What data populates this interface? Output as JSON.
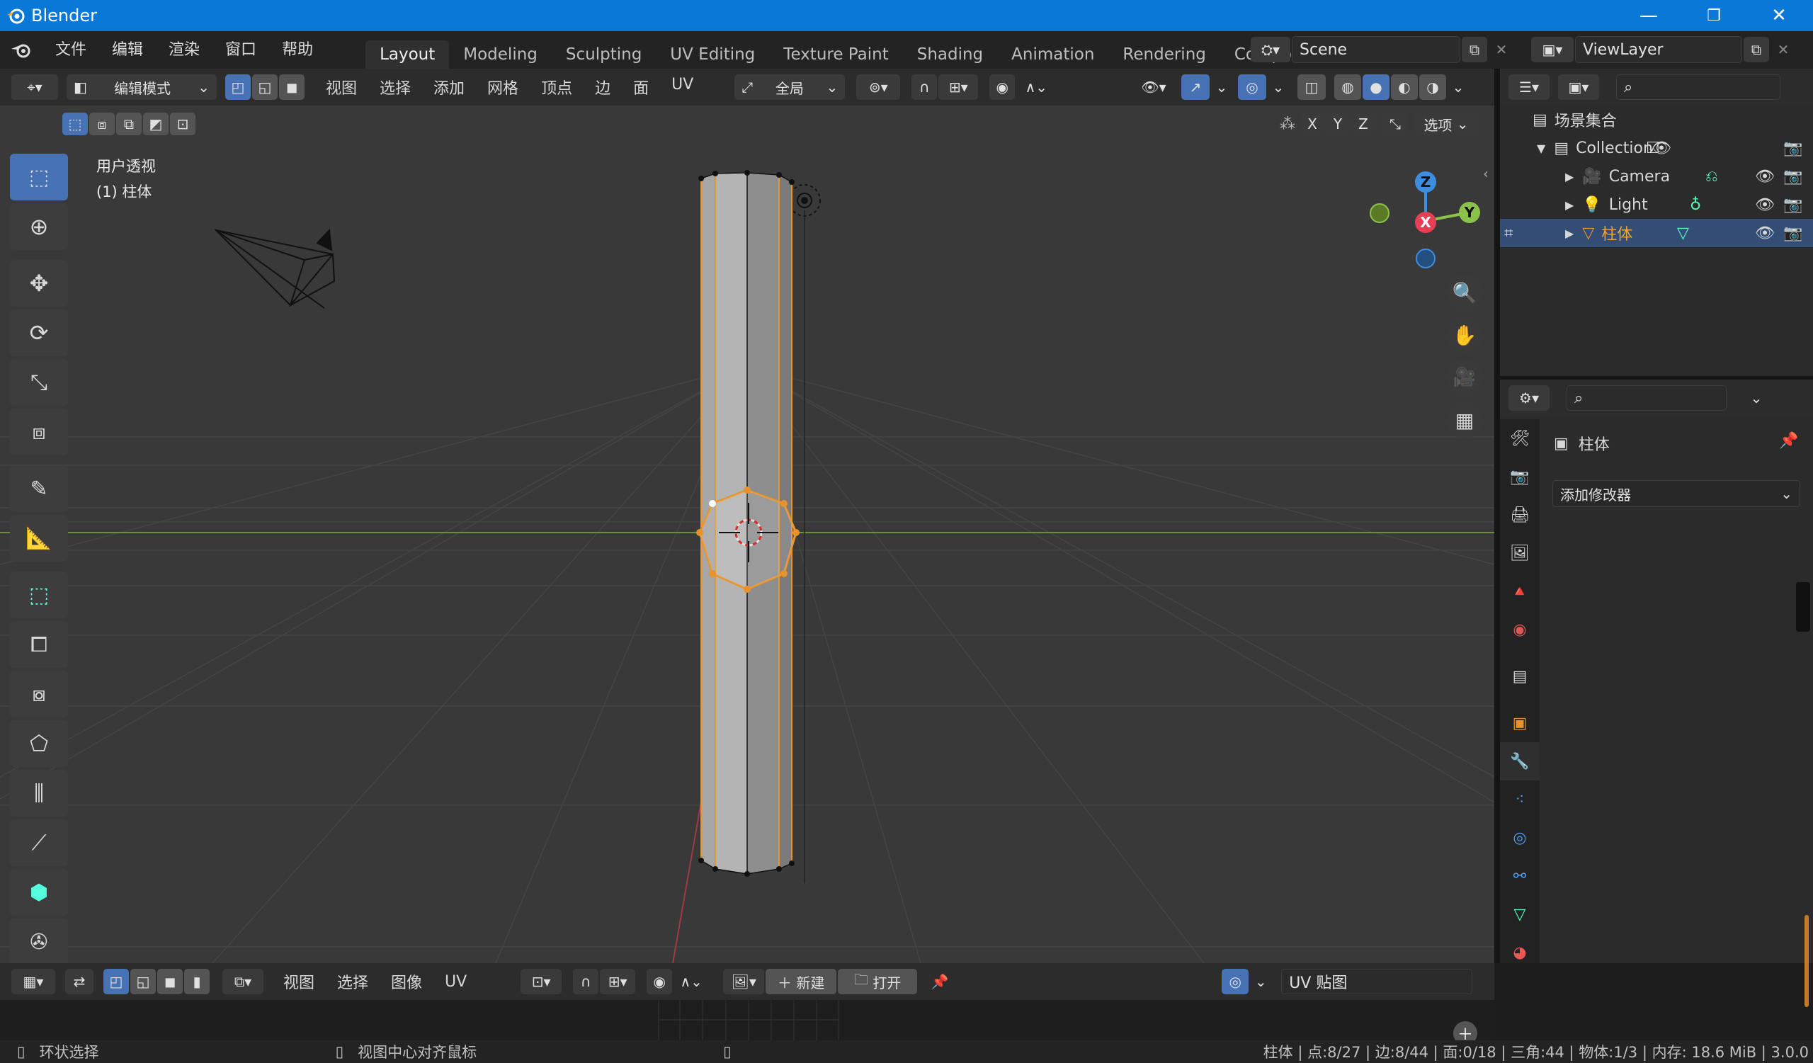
{
  "window": {
    "title": "Blender",
    "minimize": "—",
    "maximize": "❐",
    "close": "✕"
  },
  "menu": [
    "文件",
    "编辑",
    "渲染",
    "窗口",
    "帮助"
  ],
  "workspaces": [
    "Layout",
    "Modeling",
    "Sculpting",
    "UV Editing",
    "Texture Paint",
    "Shading",
    "Animation",
    "Rendering",
    "Compositing"
  ],
  "active_workspace": "Layout",
  "scene": {
    "name": "Scene"
  },
  "view_layer": {
    "name": "ViewLayer"
  },
  "viewport": {
    "mode": "编辑模式",
    "menus": [
      "视图",
      "选择",
      "添加",
      "网格",
      "顶点",
      "边",
      "面",
      "UV"
    ],
    "transform_orientation": "全局",
    "axis_labels": [
      "X",
      "Y",
      "Z"
    ],
    "options_label": "选项",
    "overlay_title": "用户透视",
    "overlay_object": "(1) 柱体",
    "gizmo": {
      "z": "Z",
      "y": "Y",
      "x": "X"
    }
  },
  "outliner": {
    "scene_collection": "场景集合",
    "items": [
      {
        "name": "Collection"
      },
      {
        "name": "Camera"
      },
      {
        "name": "Light"
      },
      {
        "name": "柱体"
      }
    ]
  },
  "properties": {
    "object_name": "柱体",
    "add_modifier": "添加修改器"
  },
  "uv_editor": {
    "menus": [
      "视图",
      "选择",
      "图像",
      "UV"
    ],
    "new_label": "新建",
    "open_label": "打开",
    "image_name": "UV 贴图"
  },
  "status": {
    "left_action": "环状选择",
    "mid_action": "视图中心对齐鼠标",
    "stats": "柱体 | 点:8/27 | 边:8/44 | 面:0/18 | 三角:44 | 物体:1/3 | 内存: 18.6 MiB | 3.0.0"
  },
  "colors": {
    "titlebar": "#0a78d7",
    "accent_blue": "#4772b3",
    "selection_orange": "#e8922a",
    "viewport_bg": "#393939",
    "axis_x": "#e63e53",
    "axis_y": "#8bc34a",
    "axis_z": "#3d8ede"
  }
}
